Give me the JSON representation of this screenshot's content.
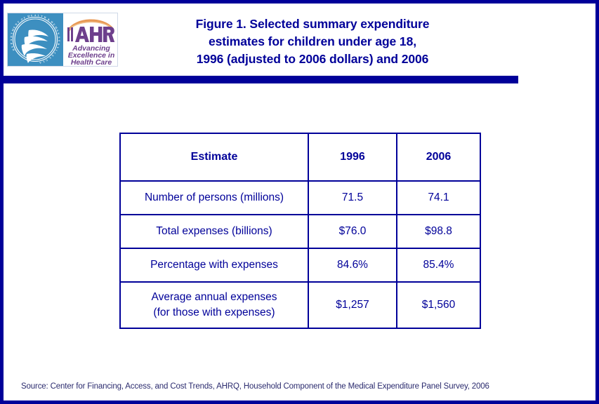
{
  "figure": {
    "title_lines": [
      "Figure 1. Selected summary expenditure",
      "estimates for children under age 18,",
      "1996 (adjusted to 2006 dollars) and 2006"
    ],
    "source": "Source: Center for Financing, Access, and Cost Trends, AHRQ, Household Component of the Medical Expenditure Panel Survey, 2006"
  },
  "logo": {
    "seal_name": "hhs-seal-icon",
    "seal_ring_text": "DEPARTMENT OF HEALTH & HUMAN SERVICES · USA",
    "agency_acronym": "AHRQ",
    "tagline_lines": [
      "Advancing",
      "Excellence in",
      "Health Care"
    ]
  },
  "colors": {
    "navy": "#000099",
    "seal_blue": "#3d8fc0",
    "ahrq_purple": "#6d3f8c",
    "arc_orange": "#e89a56",
    "source_text": "#2b2b6e"
  },
  "chart_data": {
    "type": "table",
    "title": "Figure 1. Selected summary expenditure estimates for children under age 18, 1996 (adjusted to 2006 dollars) and 2006",
    "columns": [
      "Estimate",
      "1996",
      "2006"
    ],
    "rows": [
      {
        "label": "Number of persons (millions)",
        "v1996": "71.5",
        "v2006": "74.1"
      },
      {
        "label": "Total expenses (billions)",
        "v1996": "$76.0",
        "v2006": "$98.8"
      },
      {
        "label": "Percentage with expenses",
        "v1996": "84.6%",
        "v2006": "85.4%"
      },
      {
        "label": "Average annual expenses",
        "label_line2": "(for those with expenses)",
        "v1996": "$1,257",
        "v2006": "$1,560"
      }
    ],
    "xlabel": "",
    "ylabel": "",
    "notes": "Source: Center for Financing, Access, and Cost Trends, AHRQ, Household Component of the Medical Expenditure Panel Survey, 2006"
  }
}
